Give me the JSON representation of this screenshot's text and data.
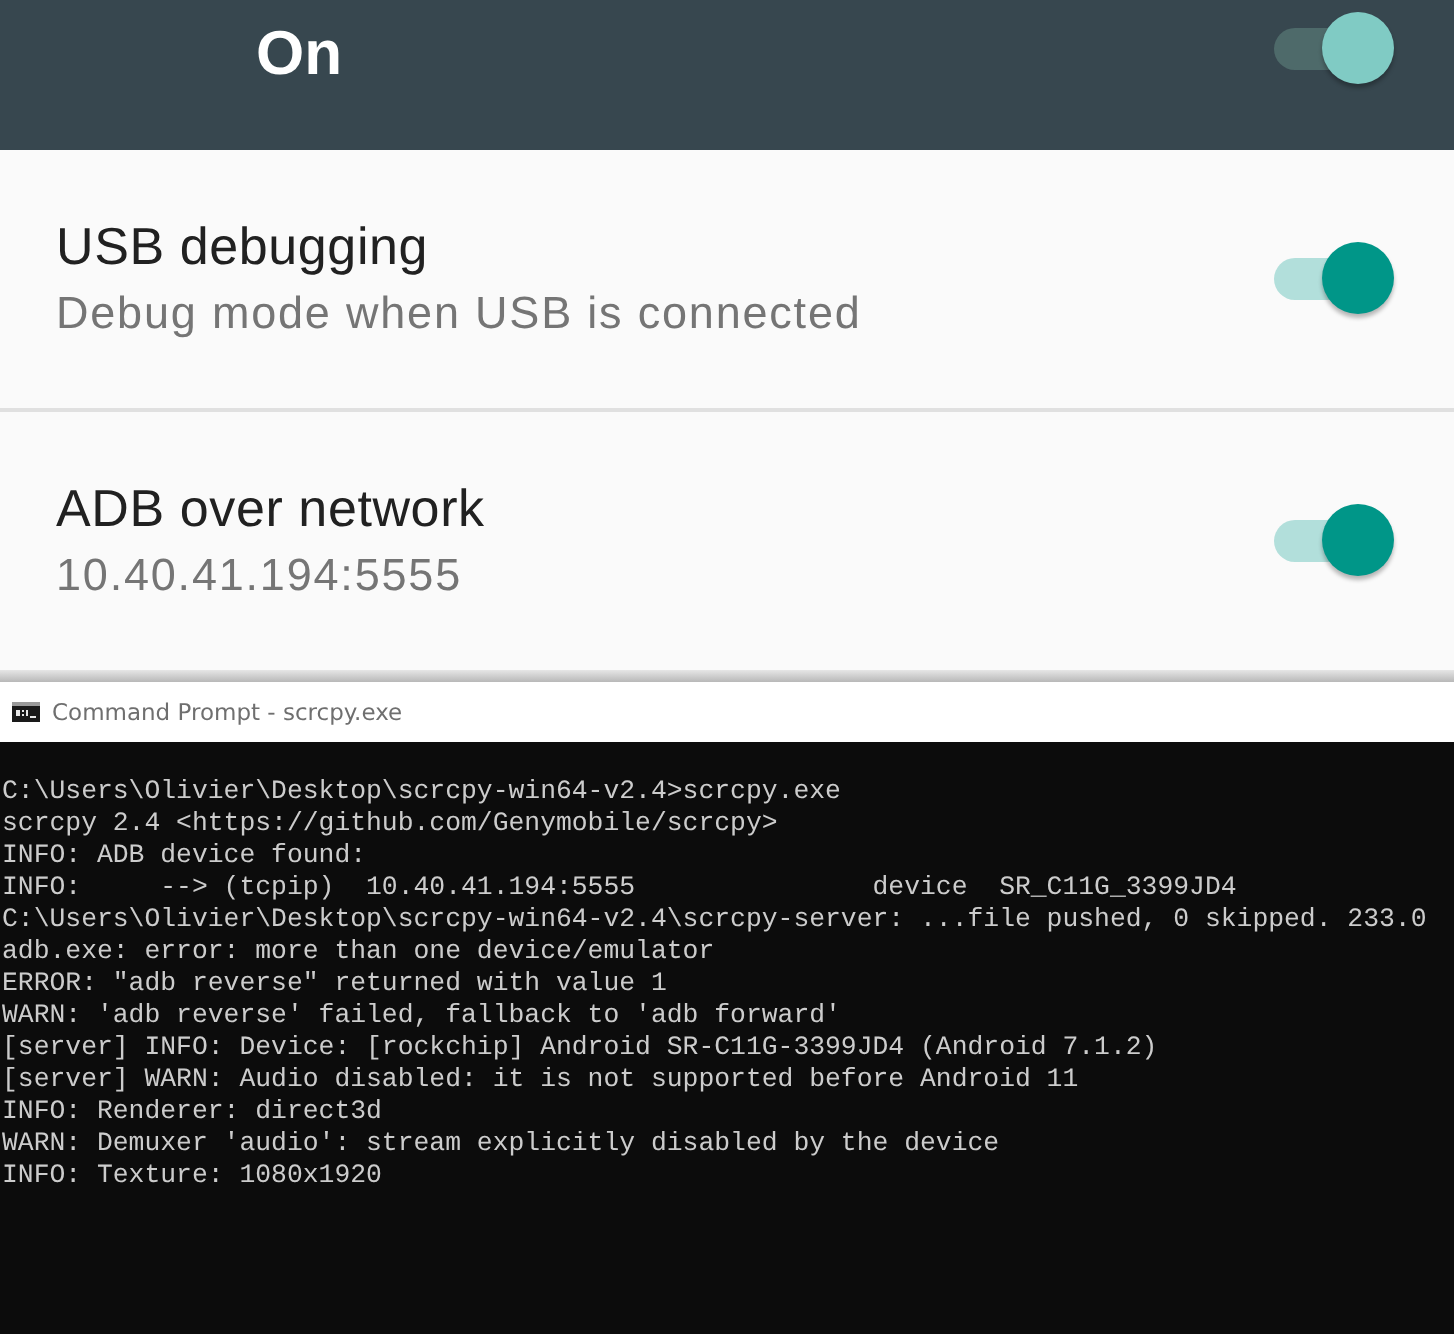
{
  "master_switch": {
    "label": "On",
    "on": true
  },
  "settings": [
    {
      "title": "USB debugging",
      "subtitle": "Debug mode when USB is connected",
      "on": true
    },
    {
      "title": "ADB over network",
      "subtitle": "10.40.41.194:5555",
      "on": true
    }
  ],
  "console_window": {
    "title": "Command Prompt - scrcpy.exe",
    "lines": [
      "C:\\Users\\Olivier\\Desktop\\scrcpy-win64-v2.4>scrcpy.exe",
      "scrcpy 2.4 <https://github.com/Genymobile/scrcpy>",
      "INFO: ADB device found:",
      "INFO:     --> (tcpip)  10.40.41.194:5555               device  SR_C11G_3399JD4",
      "C:\\Users\\Olivier\\Desktop\\scrcpy-win64-v2.4\\scrcpy-server: ...file pushed, 0 skipped. 233.0",
      "adb.exe: error: more than one device/emulator",
      "ERROR: \"adb reverse\" returned with value 1",
      "WARN: 'adb reverse' failed, fallback to 'adb forward'",
      "[server] INFO: Device: [rockchip] Android SR-C11G-3399JD4 (Android 7.1.2)",
      "[server] WARN: Audio disabled: it is not supported before Android 11",
      "INFO: Renderer: direct3d",
      "WARN: Demuxer 'audio': stream explicitly disabled by the device",
      "INFO: Texture: 1080x1920"
    ]
  }
}
